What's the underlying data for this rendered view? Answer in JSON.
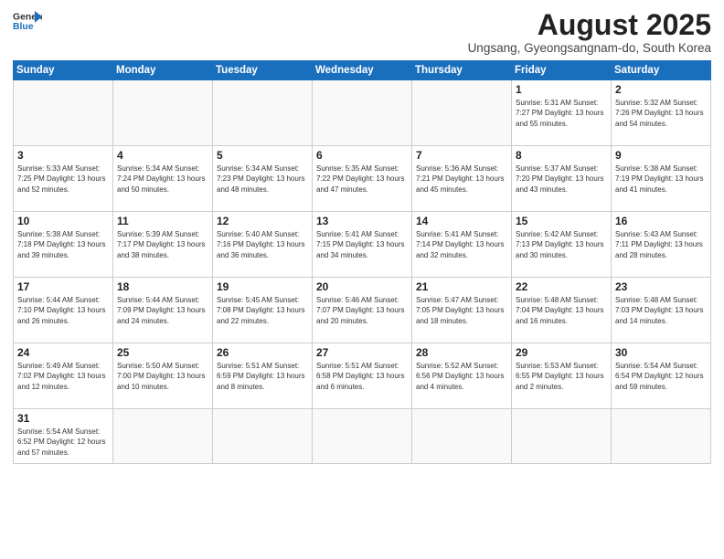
{
  "header": {
    "logo_line1": "General",
    "logo_line2": "Blue",
    "title": "August 2025",
    "subtitle": "Ungsang, Gyeongsangnam-do, South Korea"
  },
  "columns": [
    "Sunday",
    "Monday",
    "Tuesday",
    "Wednesday",
    "Thursday",
    "Friday",
    "Saturday"
  ],
  "weeks": [
    [
      {
        "day": "",
        "info": ""
      },
      {
        "day": "",
        "info": ""
      },
      {
        "day": "",
        "info": ""
      },
      {
        "day": "",
        "info": ""
      },
      {
        "day": "",
        "info": ""
      },
      {
        "day": "1",
        "info": "Sunrise: 5:31 AM\nSunset: 7:27 PM\nDaylight: 13 hours and 55 minutes."
      },
      {
        "day": "2",
        "info": "Sunrise: 5:32 AM\nSunset: 7:26 PM\nDaylight: 13 hours and 54 minutes."
      }
    ],
    [
      {
        "day": "3",
        "info": "Sunrise: 5:33 AM\nSunset: 7:25 PM\nDaylight: 13 hours and 52 minutes."
      },
      {
        "day": "4",
        "info": "Sunrise: 5:34 AM\nSunset: 7:24 PM\nDaylight: 13 hours and 50 minutes."
      },
      {
        "day": "5",
        "info": "Sunrise: 5:34 AM\nSunset: 7:23 PM\nDaylight: 13 hours and 48 minutes."
      },
      {
        "day": "6",
        "info": "Sunrise: 5:35 AM\nSunset: 7:22 PM\nDaylight: 13 hours and 47 minutes."
      },
      {
        "day": "7",
        "info": "Sunrise: 5:36 AM\nSunset: 7:21 PM\nDaylight: 13 hours and 45 minutes."
      },
      {
        "day": "8",
        "info": "Sunrise: 5:37 AM\nSunset: 7:20 PM\nDaylight: 13 hours and 43 minutes."
      },
      {
        "day": "9",
        "info": "Sunrise: 5:38 AM\nSunset: 7:19 PM\nDaylight: 13 hours and 41 minutes."
      }
    ],
    [
      {
        "day": "10",
        "info": "Sunrise: 5:38 AM\nSunset: 7:18 PM\nDaylight: 13 hours and 39 minutes."
      },
      {
        "day": "11",
        "info": "Sunrise: 5:39 AM\nSunset: 7:17 PM\nDaylight: 13 hours and 38 minutes."
      },
      {
        "day": "12",
        "info": "Sunrise: 5:40 AM\nSunset: 7:16 PM\nDaylight: 13 hours and 36 minutes."
      },
      {
        "day": "13",
        "info": "Sunrise: 5:41 AM\nSunset: 7:15 PM\nDaylight: 13 hours and 34 minutes."
      },
      {
        "day": "14",
        "info": "Sunrise: 5:41 AM\nSunset: 7:14 PM\nDaylight: 13 hours and 32 minutes."
      },
      {
        "day": "15",
        "info": "Sunrise: 5:42 AM\nSunset: 7:13 PM\nDaylight: 13 hours and 30 minutes."
      },
      {
        "day": "16",
        "info": "Sunrise: 5:43 AM\nSunset: 7:11 PM\nDaylight: 13 hours and 28 minutes."
      }
    ],
    [
      {
        "day": "17",
        "info": "Sunrise: 5:44 AM\nSunset: 7:10 PM\nDaylight: 13 hours and 26 minutes."
      },
      {
        "day": "18",
        "info": "Sunrise: 5:44 AM\nSunset: 7:09 PM\nDaylight: 13 hours and 24 minutes."
      },
      {
        "day": "19",
        "info": "Sunrise: 5:45 AM\nSunset: 7:08 PM\nDaylight: 13 hours and 22 minutes."
      },
      {
        "day": "20",
        "info": "Sunrise: 5:46 AM\nSunset: 7:07 PM\nDaylight: 13 hours and 20 minutes."
      },
      {
        "day": "21",
        "info": "Sunrise: 5:47 AM\nSunset: 7:05 PM\nDaylight: 13 hours and 18 minutes."
      },
      {
        "day": "22",
        "info": "Sunrise: 5:48 AM\nSunset: 7:04 PM\nDaylight: 13 hours and 16 minutes."
      },
      {
        "day": "23",
        "info": "Sunrise: 5:48 AM\nSunset: 7:03 PM\nDaylight: 13 hours and 14 minutes."
      }
    ],
    [
      {
        "day": "24",
        "info": "Sunrise: 5:49 AM\nSunset: 7:02 PM\nDaylight: 13 hours and 12 minutes."
      },
      {
        "day": "25",
        "info": "Sunrise: 5:50 AM\nSunset: 7:00 PM\nDaylight: 13 hours and 10 minutes."
      },
      {
        "day": "26",
        "info": "Sunrise: 5:51 AM\nSunset: 6:59 PM\nDaylight: 13 hours and 8 minutes."
      },
      {
        "day": "27",
        "info": "Sunrise: 5:51 AM\nSunset: 6:58 PM\nDaylight: 13 hours and 6 minutes."
      },
      {
        "day": "28",
        "info": "Sunrise: 5:52 AM\nSunset: 6:56 PM\nDaylight: 13 hours and 4 minutes."
      },
      {
        "day": "29",
        "info": "Sunrise: 5:53 AM\nSunset: 6:55 PM\nDaylight: 13 hours and 2 minutes."
      },
      {
        "day": "30",
        "info": "Sunrise: 5:54 AM\nSunset: 6:54 PM\nDaylight: 12 hours and 59 minutes."
      }
    ],
    [
      {
        "day": "31",
        "info": "Sunrise: 5:54 AM\nSunset: 6:52 PM\nDaylight: 12 hours and 57 minutes."
      },
      {
        "day": "",
        "info": ""
      },
      {
        "day": "",
        "info": ""
      },
      {
        "day": "",
        "info": ""
      },
      {
        "day": "",
        "info": ""
      },
      {
        "day": "",
        "info": ""
      },
      {
        "day": "",
        "info": ""
      }
    ]
  ]
}
